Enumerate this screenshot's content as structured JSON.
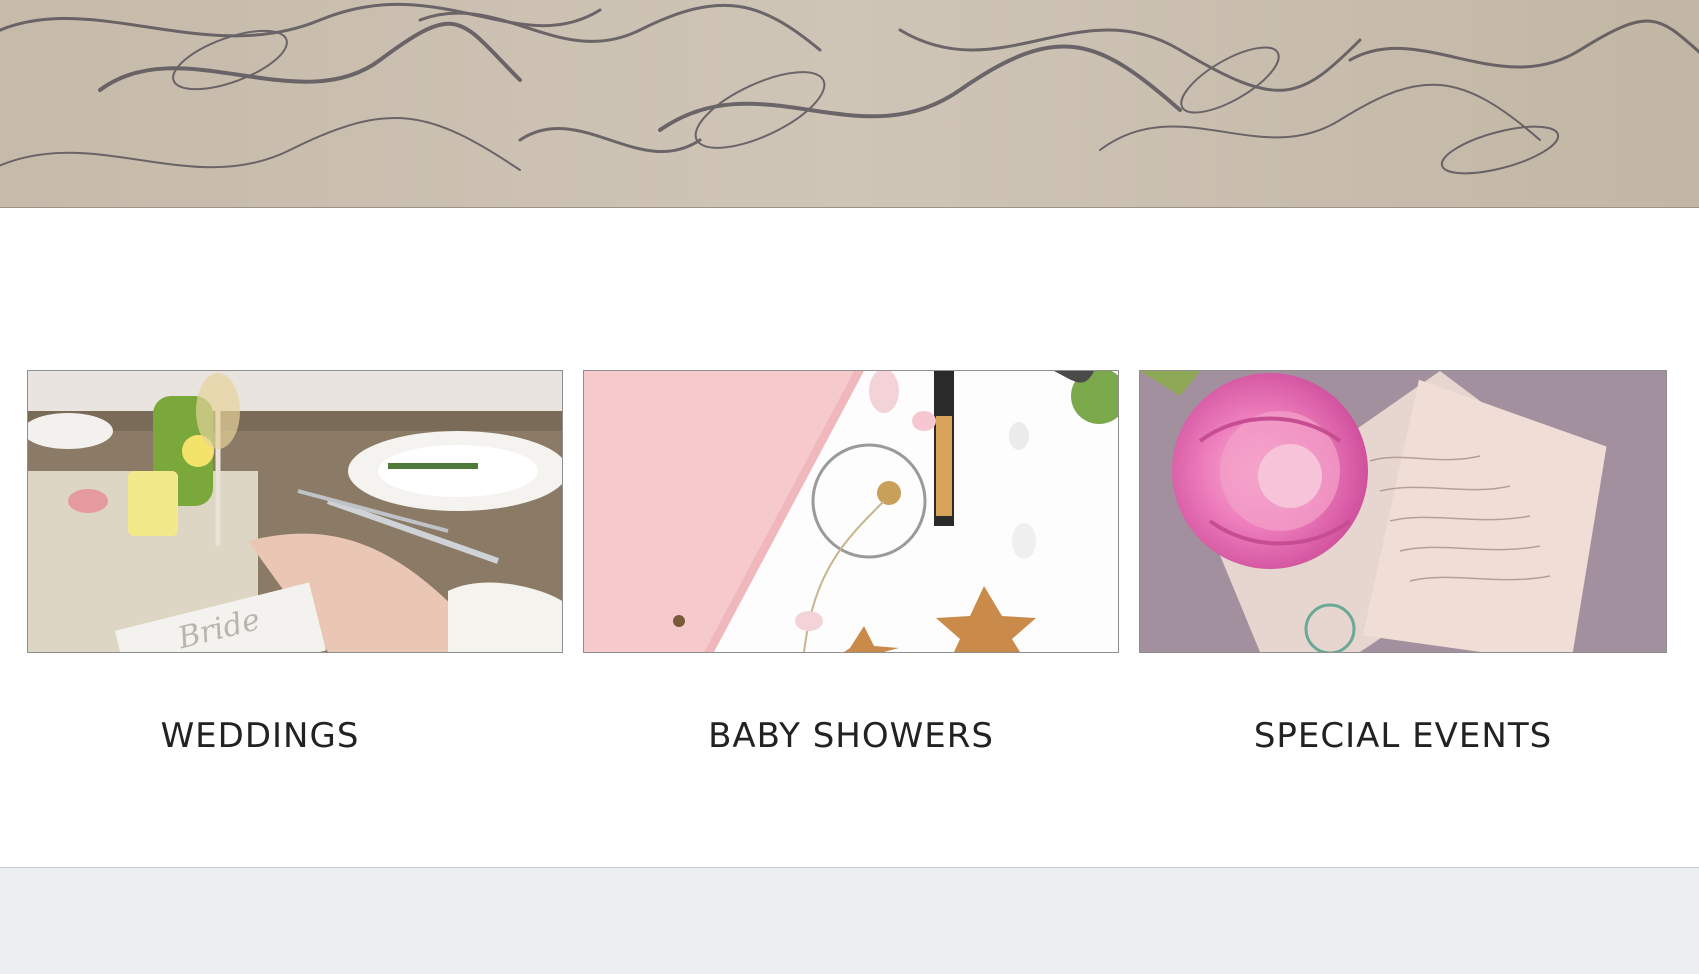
{
  "hero": {
    "image": "calligraphy-script-banner"
  },
  "categories": [
    {
      "title": "WEDDINGS",
      "image": "wedding-table-setting-photo"
    },
    {
      "title": "BABY SHOWERS",
      "image": "pink-card-stars-flatlay-photo"
    },
    {
      "title": "SPECIAL EVENTS",
      "image": "pink-rose-letters-photo"
    }
  ],
  "colors": {
    "hero_bg": "#c8bcab",
    "footer_bg": "#ebeff0",
    "title_text": "#222222"
  }
}
